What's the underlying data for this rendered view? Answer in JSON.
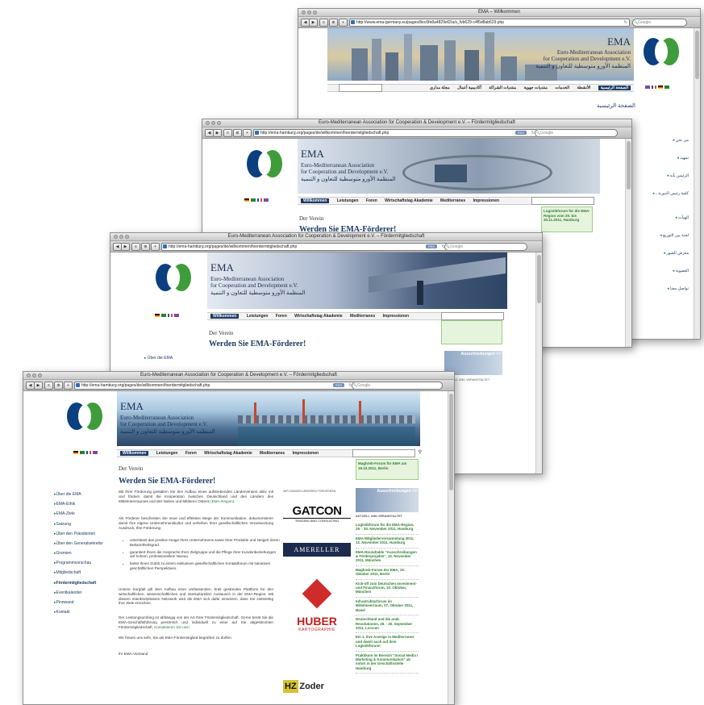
{
  "windows": {
    "w1": {
      "title": "EMA – Willkommen",
      "url": "http://www.ema-germany.eu/pages/8ec6fe8a4829ef2/a/s_fvb629-c4f5d8ab629.php",
      "search_placeholder": "Google",
      "org_name": "EMA",
      "org_line1": "Euro-Mediterranean Association",
      "org_line2": "for Cooperation and Development e.V.",
      "org_arabic": "المنظمة الأورو متوسطية للتعاون و التنمية",
      "nav": [
        "الصفحة الرئيسية",
        "الأنشطة",
        "الخدمات",
        "منتديات جهوية",
        "منتديات الشراكة",
        "أكاديمية أعمال",
        "مجلة مداري"
      ],
      "page_heading": "الصفحة الرئيسية",
      "sidebar": [
        "من نحن",
        "تمهيد",
        "الرئيس يأبه",
        "كلمة رئيس الدورة...",
        "الهيآت",
        "لجنة بين التوزيع",
        "معرض الصور",
        "العضوية",
        "تواصل معنا"
      ]
    },
    "w2": {
      "title": "Euro-Mediterranean Association for Cooperation & Development e.V. – Fördermitgliedschaft",
      "url": "http://ema-hamburg.org/pages/de/willkommen/foerdermitgliedschaft.php",
      "search_placeholder": "Google",
      "org_name": "EMA",
      "org_line1": "Euro-Mediterranean Association",
      "org_line2": "for Cooperation and Development e.V.",
      "org_arabic": "المنظمة الأورو متوسطية للتعاون و التنمية",
      "nav": [
        "Willkommen",
        "Leistungen",
        "Foren",
        "Wirtschaftstag Akademie",
        "Mediterranes",
        "Impressionen"
      ],
      "section": "Der Verein",
      "heading": "Werden Sie EMA-Förderer!",
      "greenbox": "Logistikforum für die EMA-Region vom 29. bis 30.11.2011, Hamburg"
    },
    "w3": {
      "title": "Euro-Mediterranean Association for Cooperation & Development e.V. – Fördermitgliedschaft",
      "url": "http://ema-hamburg.org/pages/de/willkommen/foerdermitgliedschaft.php",
      "search_placeholder": "Google",
      "org_name": "EMA",
      "org_line1": "Euro-Mediterranean Association",
      "org_line2": "for Cooperation and Development e.V.",
      "org_arabic": "المنظمة الأورو متوسطية للتعاون و التنمية",
      "nav": [
        "Willkommen",
        "Leistungen",
        "Foren",
        "Wirtschaftstag Akademie",
        "Mediterranes",
        "Impressionen"
      ],
      "section": "Der Verein",
      "heading": "Werden Sie EMA-Förderer!",
      "sidebar_first": "Über die EMA",
      "news_header": "Ausschreibungen >>",
      "news_sub": "AKTUELL UND VERANSTALTET"
    },
    "w4": {
      "title": "Euro-Mediterranean Association for Cooperation & Development e.V. – Fördermitgliedschaft",
      "url": "http://ema-hamburg.org/pages/de/willkommen/foerdermitgliedschaft.php",
      "search_placeholder": "Google",
      "org_name": "EMA",
      "org_line1": "Euro-Mediterranean Association",
      "org_line2": "for Cooperation and Development e.V.",
      "org_arabic": "المنظمة الأورو متوسطية للتعاون و التنمية",
      "nav": [
        "Willkommen",
        "Leistungen",
        "Foren",
        "Wirtschaftstag Akademie",
        "Mediterranes",
        "Impressionen"
      ],
      "section": "Der Verein",
      "heading": "Werden Sie EMA-Förderer!",
      "sidebar": [
        "Über die EMA",
        "EMA-Ethik",
        "EMA-Ziele",
        "Satzung",
        "Über den Präsidenten",
        "Über den Generalsekretär",
        "Gremien",
        "Programmvorschau",
        "Mitgliedschaft",
        "Fördermitgliedschaft",
        "Eventkalender",
        "Pinnwand",
        "Kontakt"
      ],
      "p1": "Mit Ihrer Förderung gestalten Sie den Aufbau eines aufstrebenden Länderverains aktiv mit und fördern damit die Kooperation zwischen Deutschland und den Ländern des Mittelmeerraumes und des Nahen und Mittleren Ostens",
      "p1_link": "(EMA-Region).",
      "p2": "Als Förderer beschreiten Sie neue und effektive Wege der Kommunikation, dokumentieren damit Ihre eigene Unternehmenskultur und verleihen Ihrer gesellschaftlichen Verantwortung Ausdruck. Ihre Förderung",
      "bullets": [
        "unterstützt das positive Image Ihres Unternehmens sowie Ihrer Produkte und steigert deren Bekanntheitsgrad.",
        "garantiert Ihnen die Ansprache Ihrer Zielgruppe und die Pflege Ihrer Kundenbeziehungen auf hohem, professionellem Niveau.",
        "bietet Ihnen Zutritt zu einem exklusiven gesellschaftlichen Kontaktforum mit lukrativen geschäftlichen Perspektiven."
      ],
      "p3": "Unsere Sorgfalt gilt dem Aufbau einer umfassenden, breit gestreuten Plattform für den wirtschaftlichen, wissenschaftlichen und interkulturellen Austausch in der EMA-Region. Mit diesem interdisziplinären Netzwerk wird die EMA sich dafür einsetzen, dass Sie zielstrebig Ihre Ziele erreichen.",
      "p4": "Der Leistungsumfang ist abhängig von der Art Ihrer Fördermitgliedschaft. Gerne berät Sie die EMA-Geschäftsführung persönlich und individuell zu einer auf Sie abgestimmten Fördermitgliedschaft.",
      "p4_link": "Kontaktieren Sie uns!",
      "p5": "Wir freuen uns sehr, Sie als EMA-Fördermitglied begrüßen zu dürfen.",
      "signature": "Ihr EMA-Vorstand",
      "sponsors_caption": "WIR DANKEN UNSEREN FÖRDERERN",
      "sponsors": [
        "GATCON",
        "TRADING AND CONSULTING",
        "AMERELLER",
        "HUBER",
        "KARTOGRAPHIE",
        "HZ",
        "Zoder"
      ],
      "greenbox": "Maghreb-Forum für EMA am 19.10.2011, Berlin",
      "news_header": "Ausschreibungen >>",
      "news_sub": "AKTUELL UND VERANSTALTET",
      "news": [
        "Logistikforum für die EMA-Region, 29. - 30. November 2011, Hamburg",
        "EMA-Mitgliederversammlung 2011, 12. November 2011, Hamburg",
        "EMA-Roundtable \"Ausschreibungen & Förderprojekte\", 15. November 2011, München",
        "Maghreb-Forum der EMA, 19. Oktober 2011, Berlin",
        "Kick-off zum Deutschen Investment- und Finanzforum, 10. Oktober, München",
        "Infrastrukturforum im Mittelmeerraum, 07. Oktober 2011, Basel",
        "Deutschland und die arab. Revolutionen, 28. - 30. September 2011, Loccum",
        "Ein 1. ihre Anzeige in Mediterranes und damit auch auf dem Logistikforum!",
        "Praktikum im Bereich \"Social Media / Marketing & Kommunikation\" ab sofort in der Geschäftsstelle Hamburg"
      ]
    }
  },
  "colors": {
    "navy": "#1d3a66",
    "green": "#2e7d32",
    "logo_blue": "#0c3f7f",
    "logo_green": "#3f9c3a"
  }
}
